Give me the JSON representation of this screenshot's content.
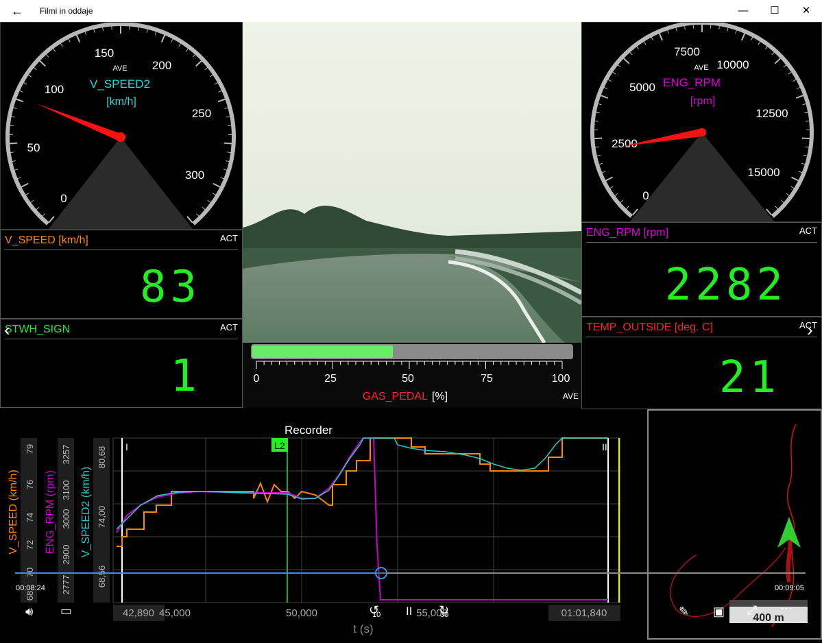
{
  "window": {
    "title": "Filmi in oddaje",
    "back": "←",
    "minimize": "—",
    "maximize": "☐",
    "close": "✕"
  },
  "gauge_speed": {
    "label": "V_SPEED2",
    "unit": "[km/h]",
    "mode": "AVE",
    "ticks": [
      "0",
      "50",
      "100",
      "150",
      "200",
      "250",
      "300"
    ],
    "value": 110
  },
  "gauge_rpm": {
    "label": "ENG_RPM",
    "unit": "[rpm]",
    "mode": "AVE",
    "ticks": [
      "0",
      "2500",
      "5000",
      "7500",
      "10000",
      "12500",
      "15000"
    ],
    "value": 2700
  },
  "panels": {
    "v_speed": {
      "label": "V_SPEED [km/h]",
      "mode": "ACT",
      "value": "83",
      "color": "#ff8800"
    },
    "stwh": {
      "label": "STWH_SIGN",
      "mode": "ACT",
      "value": "1",
      "color": "#22ee22"
    },
    "eng_rpm": {
      "label": "ENG_RPM [rpm]",
      "mode": "ACT",
      "value": "2282",
      "color": "#dd00dd"
    },
    "temp": {
      "label": "TEMP_OUTSIDE [deg. C]",
      "mode": "ACT",
      "value": "21",
      "color": "#ff2222"
    }
  },
  "gas_pedal": {
    "label": "GAS_PEDAL",
    "unit": "[%]",
    "mode": "AVE",
    "ticks": [
      "0",
      "25",
      "50",
      "75",
      "100"
    ],
    "fill_percent": 44
  },
  "recorder": {
    "title": "Recorder",
    "marker": "L2",
    "axis_labels": [
      "V_SPEED (km/h)",
      "ENG_RPM (rpm)",
      "V_SPEED2 (km/h)"
    ],
    "speed_ticks": [
      "79",
      "76",
      "74",
      "72",
      "70",
      "68"
    ],
    "rpm_ticks": [
      "3257",
      "3100",
      "3000",
      "2900",
      "2777"
    ],
    "speed2_ticks": [
      "80,68",
      "74,00",
      "68,56"
    ],
    "x_ticks": [
      "42,890",
      "45,000",
      "50,000",
      "55,000",
      "01:01,840"
    ],
    "x_label": "t (s)",
    "markers": [
      "I",
      "II"
    ]
  },
  "map": {
    "scale": "400 m"
  },
  "player": {
    "time_current": "00:08:24",
    "time_total": "00:09:05",
    "progress": 0.925,
    "volume_icon": "volume-icon",
    "captions_icon": "captions-icon",
    "rewind_label": "10",
    "forward_label": "30",
    "pause": "II"
  },
  "chart_data": {
    "type": "line",
    "title": "Recorder",
    "xlabel": "t (s)",
    "series": [
      {
        "name": "V_SPEED (km/h)",
        "color": "#ff8800"
      },
      {
        "name": "ENG_RPM (rpm)",
        "color": "#cc00cc"
      },
      {
        "name": "V_SPEED2 (km/h)",
        "color": "#22cccc"
      }
    ]
  }
}
